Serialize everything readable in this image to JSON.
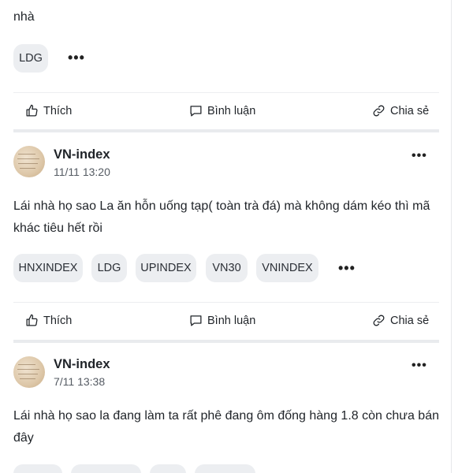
{
  "posts": [
    {
      "text_line2": "nhà",
      "tags": [
        "LDG"
      ]
    },
    {
      "author": "VN-index",
      "time": "11/11 13:20",
      "text": "Lái nhà họ sao La ăn hỗn uống tạp( toàn trà đá) mà không dám kéo thì mã khác tiêu hết rồi",
      "tags": [
        "HNXINDEX",
        "LDG",
        "UPINDEX",
        "VN30",
        "VNINDEX"
      ]
    },
    {
      "author": "VN-index",
      "time": "7/11 13:38",
      "text": "Lái nhà họ sao la đang làm ta rất phê đang ôm đống hàng 1.8 còn chưa bán đây"
    }
  ],
  "actions": {
    "like": "Thích",
    "comment": "Bình luận",
    "share": "Chia sẻ"
  },
  "more_label": "•••",
  "icons": [
    "thumbs-up-icon",
    "comment-icon",
    "share-link-icon",
    "more-icon"
  ]
}
